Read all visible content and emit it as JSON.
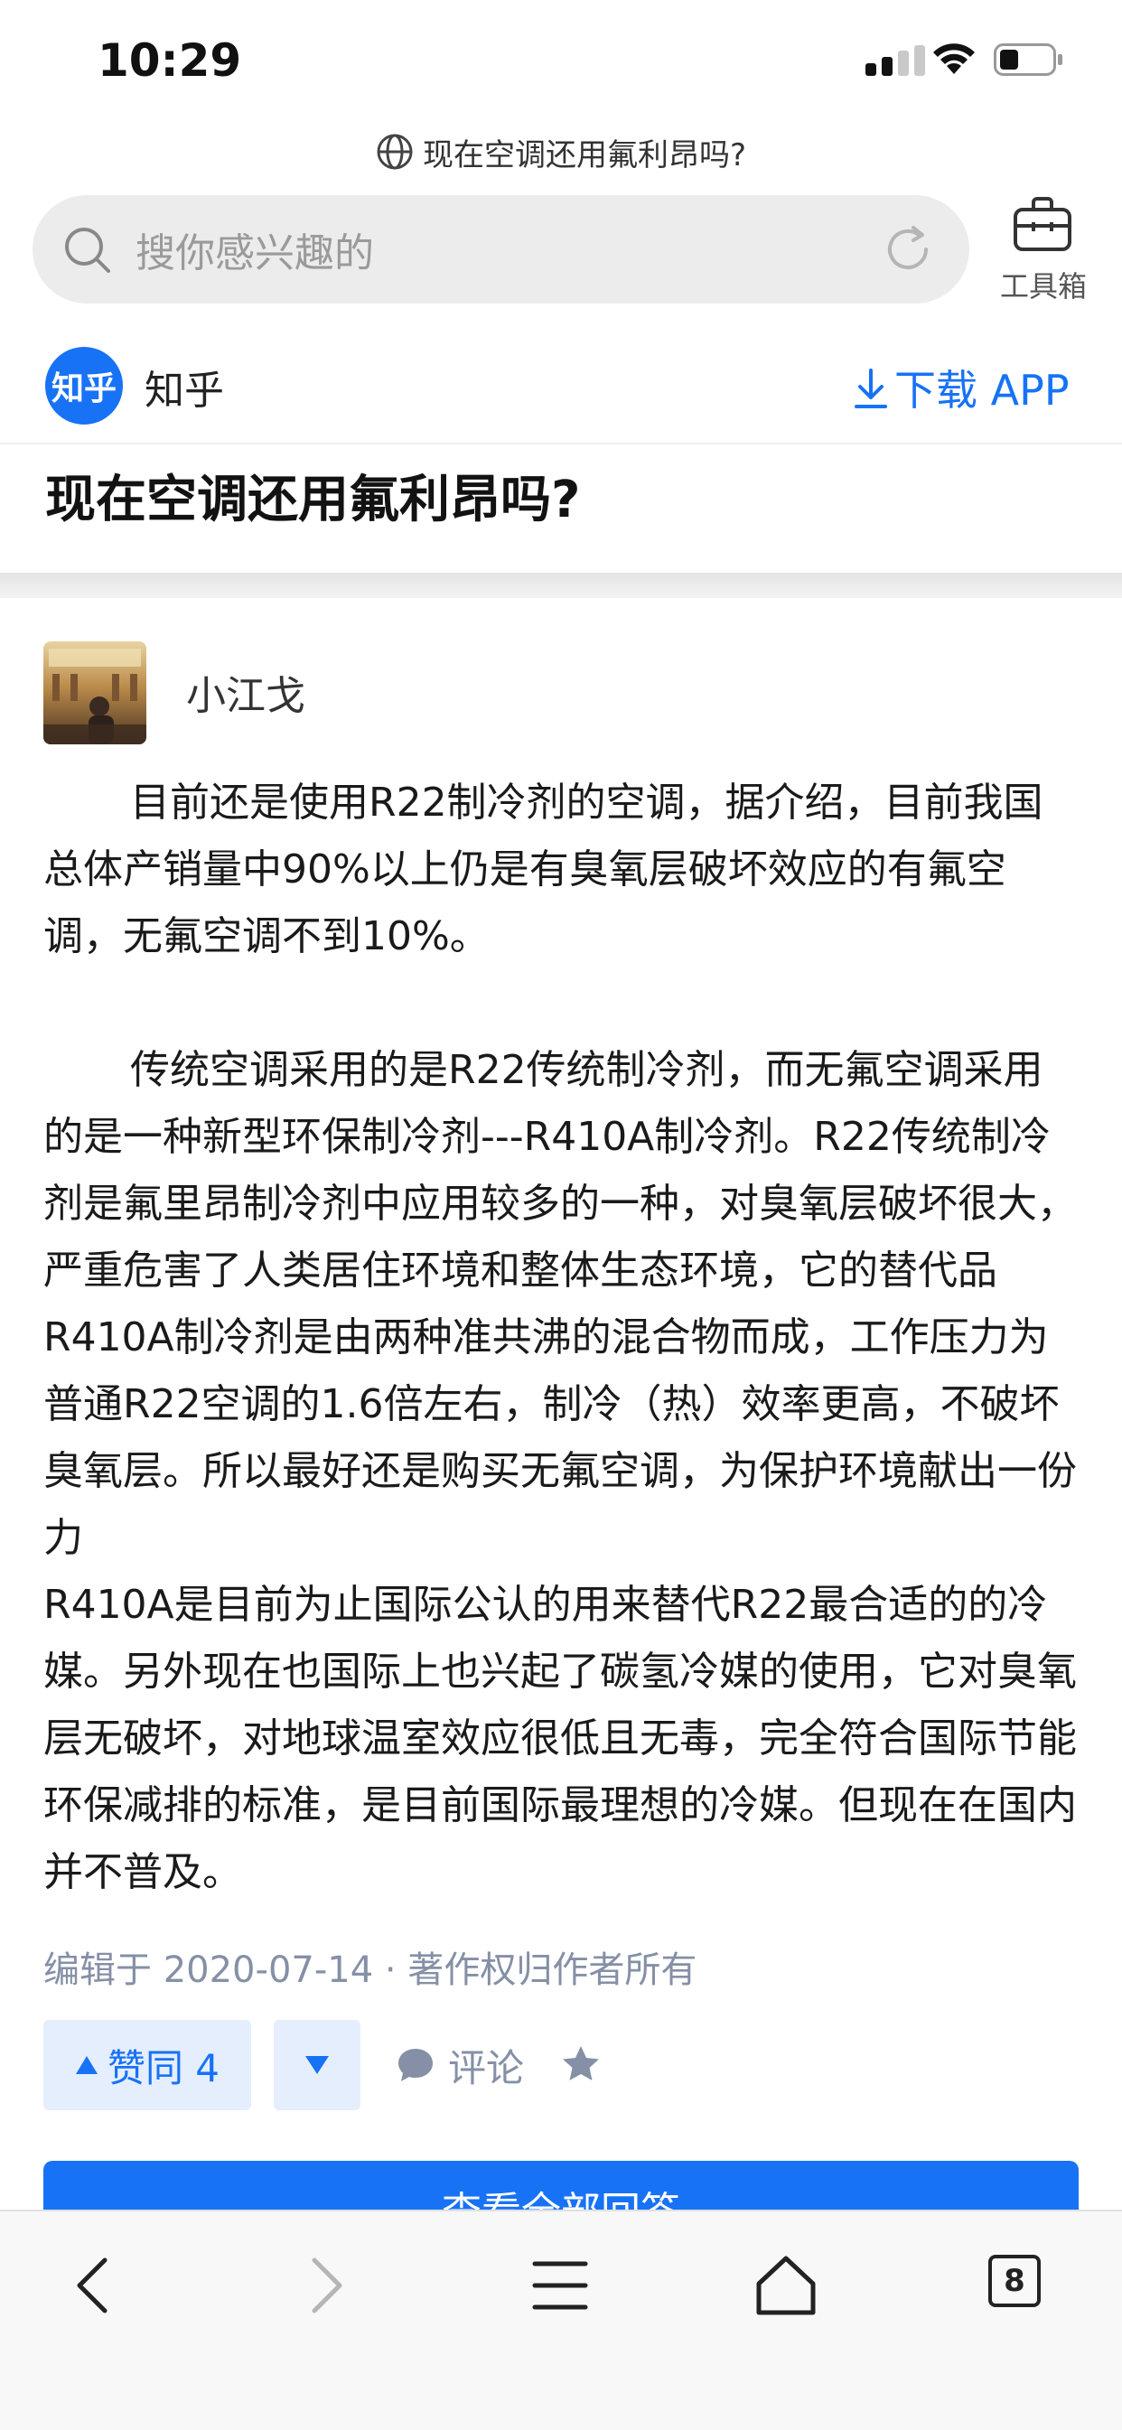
{
  "status_bar": {
    "time": "10:29"
  },
  "url_bar": {
    "title": "现在空调还用氟利昂吗?"
  },
  "search": {
    "placeholder": "搜你感兴趣的"
  },
  "toolbox": {
    "label": "工具箱"
  },
  "site": {
    "logo_text": "知乎",
    "name": "知乎",
    "download_label": "下载 APP"
  },
  "question": {
    "title": "现在空调还用氟利昂吗?"
  },
  "answer": {
    "author": "小江戈",
    "paragraph1": "目前还是使用R22制冷剂的空调，据介绍，目前我国总体产销量中90%以上仍是有臭氧层破坏效应的有氟空调，无氟空调不到10%。",
    "paragraph2": "传统空调采用的是R22传统制冷剂，而无氟空调采用的是一种新型环保制冷剂---R410A制冷剂。R22传统制冷剂是氟里昂制冷剂中应用较多的一种，对臭氧层破坏很大，严重危害了人类居住环境和整体生态环境，它的替代品R410A制冷剂是由两种准共沸的混合物而成，工作压力为普通R22空调的1.6倍左右，制冷（热）效率更高，不破坏臭氧层。所以最好还是购买无氟空调，为保护环境献出一份力",
    "paragraph3": "R410A是目前为止国际公认的用来替代R22最合适的的冷媒。另外现在也国际上也兴起了碳氢冷媒的使用，它对臭氧层无破坏，对地球温室效应很低且无毒，完全符合国际节能环保减排的标准，是目前国际最理想的冷媒。但现在在国内并不普及。",
    "edited": "编辑于 2020-07-14 · 著作权归作者所有"
  },
  "actions": {
    "upvote_label": "赞同 4",
    "comment_label": "评论"
  },
  "view_all_label": "查看全部回答",
  "bottom_nav": {
    "tab_count": "8"
  },
  "colors": {
    "accent": "#1772f6",
    "vote_bg": "#e5eefc",
    "meta_gray": "#8590a6"
  }
}
